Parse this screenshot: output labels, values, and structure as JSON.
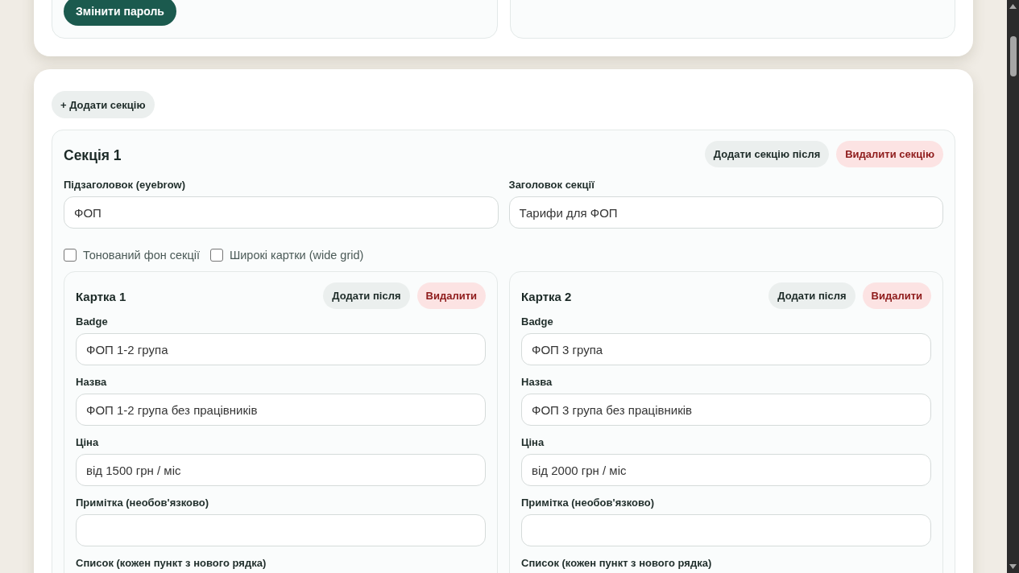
{
  "account_panel": {
    "change_password_button": "Змінити пароль"
  },
  "content_panel": {
    "add_section_button": "+ Додати секцію",
    "sections": [
      {
        "title": "Секція 1",
        "actions": [
          {
            "label": "Додати секцію після",
            "kind": "neutral"
          },
          {
            "label": "Видалити секцію",
            "kind": "danger"
          }
        ],
        "fields": [
          {
            "label": "Підзаголовок (eyebrow)",
            "value": "ФОП"
          },
          {
            "label": "Заголовок секції",
            "value": "Тарифи для ФОП"
          }
        ],
        "options": [
          {
            "label": "Тонований фон секції",
            "checked": false
          },
          {
            "label": "Широкі картки (wide grid)",
            "checked": false
          }
        ],
        "cards": [
          {
            "title": "Картка 1",
            "actions": [
              {
                "label": "Додати після",
                "kind": "neutral"
              },
              {
                "label": "Видалити",
                "kind": "danger"
              }
            ],
            "fields": [
              {
                "label": "Badge",
                "value": "ФОП 1-2 група"
              },
              {
                "label": "Назва",
                "value": "ФОП 1-2 група без працівників"
              },
              {
                "label": "Ціна",
                "value": "від 1500 грн / міс"
              },
              {
                "label": "Примітка (необов'язково)"
              },
              {
                "label": "Список (кожен пункт з нового рядка)"
              }
            ]
          },
          {
            "title": "Картка 2",
            "actions": [
              {
                "label": "Додати після",
                "kind": "neutral"
              },
              {
                "label": "Видалити",
                "kind": "danger"
              }
            ],
            "fields": [
              {
                "label": "Badge",
                "value": "ФОП 3 група"
              },
              {
                "label": "Назва",
                "value": "ФОП 3 група без працівників"
              },
              {
                "label": "Ціна",
                "value": "від 2000 грн / міс"
              },
              {
                "label": "Примітка (необов'язково)"
              },
              {
                "label": "Список (кожен пункт з нового рядка)"
              }
            ]
          }
        ]
      }
    ]
  }
}
